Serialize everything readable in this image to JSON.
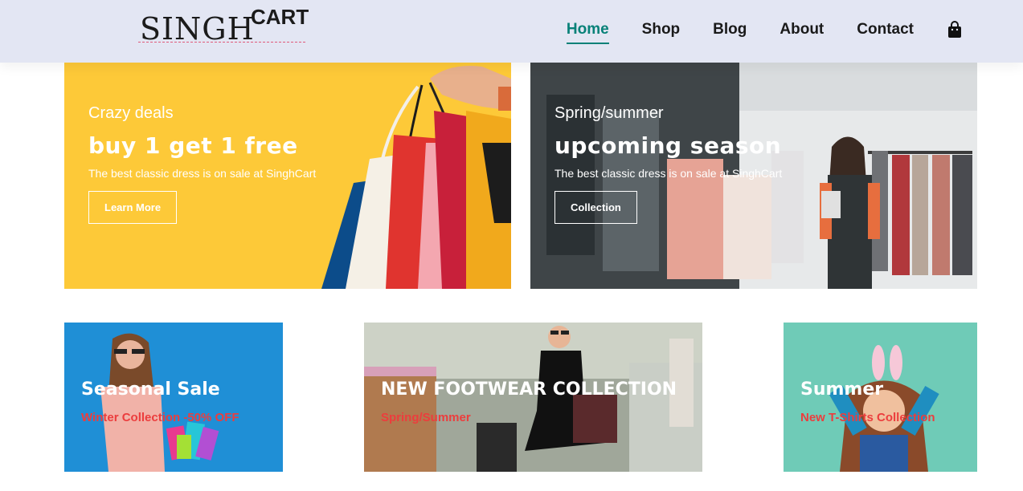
{
  "logo": {
    "main": "SINGH",
    "sup": "CART"
  },
  "nav": {
    "items": [
      "Home",
      "Shop",
      "Blog",
      "About",
      "Contact"
    ],
    "active": "Home",
    "cart_icon": "shopping-bag-icon"
  },
  "banners": [
    {
      "subtitle": "Crazy deals",
      "title": "buy 1 get 1 free",
      "description": "The best classic dress is on sale at SinghCart",
      "button": "Learn More"
    },
    {
      "subtitle": "Spring/summer",
      "title": "upcoming season",
      "description": "The best classic dress is on sale at SinghCart",
      "button": "Collection"
    }
  ],
  "promos": [
    {
      "title": "Seasonal Sale",
      "subtitle": "Winter Collection -50% OFF"
    },
    {
      "title": "NEW FOOTWEAR COLLECTION",
      "subtitle": "Spring/Summer"
    },
    {
      "title": "Summer",
      "subtitle": "New T-Shirts Collection"
    }
  ],
  "colors": {
    "header_bg": "#e3e6f3",
    "accent": "#088178",
    "promo_red": "#ec3d3d",
    "yellow_banner": "#fdc938"
  }
}
